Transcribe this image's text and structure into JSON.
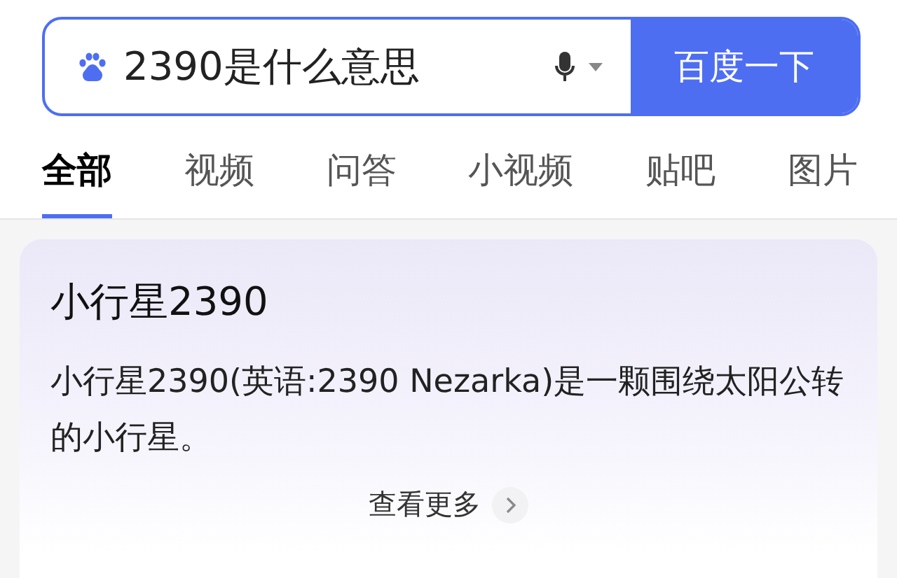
{
  "search": {
    "value": "2390是什么意思",
    "button": "百度一下"
  },
  "tabs": [
    {
      "label": "全部",
      "selected": true
    },
    {
      "label": "视频",
      "selected": false
    },
    {
      "label": "问答",
      "selected": false
    },
    {
      "label": "小视频",
      "selected": false
    },
    {
      "label": "贴吧",
      "selected": false
    },
    {
      "label": "图片",
      "selected": false
    }
  ],
  "card": {
    "title": "小行星2390",
    "text": "小行星2390(英语:2390 Nezarka)是一颗围绕太阳公转的小行星。",
    "more": "查看更多"
  }
}
